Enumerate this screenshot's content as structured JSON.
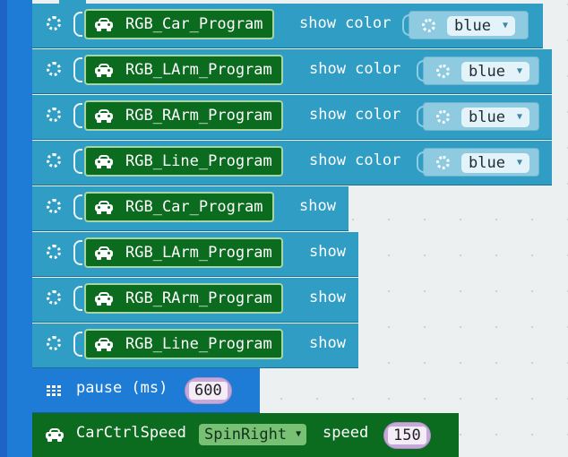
{
  "rows_color": [
    {
      "program": "RGB_Car_Program",
      "action": "show color",
      "color": "blue"
    },
    {
      "program": "RGB_LArm_Program",
      "action": "show color",
      "color": "blue"
    },
    {
      "program": "RGB_RArm_Program",
      "action": "show color",
      "color": "blue"
    },
    {
      "program": "RGB_Line_Program",
      "action": "show color",
      "color": "blue"
    }
  ],
  "rows_show": [
    {
      "program": "RGB_Car_Program",
      "action": "show"
    },
    {
      "program": "RGB_LArm_Program",
      "action": "show"
    },
    {
      "program": "RGB_RArm_Program",
      "action": "show"
    },
    {
      "program": "RGB_Line_Program",
      "action": "show"
    }
  ],
  "pause": {
    "label": "pause (ms)",
    "value": "600"
  },
  "speed": {
    "label": "CarCtrlSpeed",
    "mode": "SpinRight",
    "speed_label": "speed",
    "value": "150"
  },
  "colors": {
    "spine": "#1e64c8",
    "neopixel_block": "#2f9dc4",
    "car_block": "#0b6b1e",
    "basic_block": "#1f7cd6",
    "math_slot": "#c7a9d9"
  }
}
